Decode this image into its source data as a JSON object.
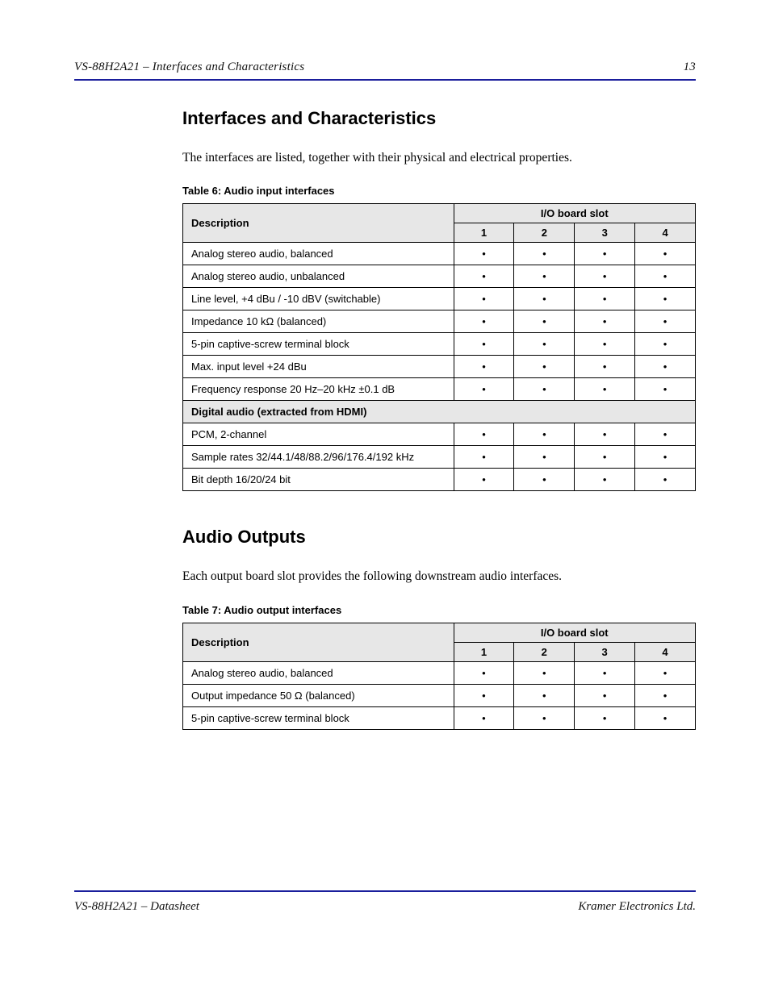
{
  "header": {
    "left": "VS-88H2A21 – Interfaces and Characteristics",
    "right": "13"
  },
  "footer": {
    "left": "VS-88H2A21 – Datasheet",
    "right": "Kramer Electronics Ltd."
  },
  "section1": {
    "title": "Interfaces and Characteristics",
    "intro": "The interfaces are listed, together with their physical and electrical properties.",
    "table_caption": "Table 6: Audio input interfaces",
    "table": {
      "head_desc": "Description",
      "group_head": "I/O board slot",
      "sub_heads": [
        "1",
        "2",
        "3",
        "4"
      ],
      "rows": [
        {
          "desc": "Analog stereo audio, balanced",
          "vals": [
            "•",
            "•",
            "•",
            "•"
          ]
        },
        {
          "desc": "Analog stereo audio, unbalanced",
          "vals": [
            "•",
            "•",
            "•",
            "•"
          ]
        },
        {
          "desc": "Line level, +4 dBu / -10 dBV (switchable)",
          "vals": [
            "•",
            "•",
            "•",
            "•"
          ]
        },
        {
          "desc": "Impedance 10 kΩ (balanced)",
          "vals": [
            "•",
            "•",
            "•",
            "•"
          ]
        },
        {
          "desc": "5-pin captive-screw terminal block",
          "vals": [
            "•",
            "•",
            "•",
            "•"
          ]
        },
        {
          "desc": "Max. input level +24 dBu",
          "vals": [
            "•",
            "•",
            "•",
            "•"
          ]
        },
        {
          "desc": "Frequency response 20 Hz–20 kHz ±0.1 dB",
          "vals": [
            "•",
            "•",
            "•",
            "•"
          ]
        }
      ],
      "section_row": "Digital audio (extracted from HDMI)",
      "rows2": [
        {
          "desc": "PCM, 2-channel",
          "vals": [
            "•",
            "•",
            "•",
            "•"
          ]
        },
        {
          "desc": "Sample rates 32/44.1/48/88.2/96/176.4/192 kHz",
          "vals": [
            "•",
            "•",
            "•",
            "•"
          ]
        },
        {
          "desc": "Bit depth 16/20/24 bit",
          "vals": [
            "•",
            "•",
            "•",
            "•"
          ]
        }
      ]
    }
  },
  "section2": {
    "title": "Audio Outputs",
    "intro": "Each output board slot provides the following downstream audio interfaces.",
    "table_caption": "Table 7: Audio output interfaces",
    "table": {
      "head_desc": "Description",
      "group_head": "I/O board slot",
      "sub_heads": [
        "1",
        "2",
        "3",
        "4"
      ],
      "rows": [
        {
          "desc": "Analog stereo audio, balanced",
          "vals": [
            "•",
            "•",
            "•",
            "•"
          ]
        },
        {
          "desc": "Output impedance 50 Ω (balanced)",
          "vals": [
            "•",
            "•",
            "•",
            "•"
          ]
        },
        {
          "desc": "5-pin captive-screw terminal block",
          "vals": [
            "•",
            "•",
            "•",
            "•"
          ]
        }
      ]
    }
  }
}
